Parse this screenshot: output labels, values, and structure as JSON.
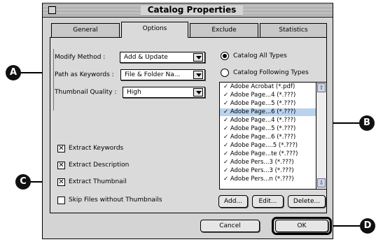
{
  "window": {
    "title": "Catalog Properties"
  },
  "tabs": [
    {
      "label": "General",
      "active": false
    },
    {
      "label": "Options",
      "active": true
    },
    {
      "label": "Exclude",
      "active": false
    },
    {
      "label": "Statistics",
      "active": false
    }
  ],
  "options": {
    "modify_method": {
      "label": "Modify Method :",
      "value": "Add & Update"
    },
    "path_as_keywords": {
      "label": "Path as Keywords :",
      "value": "File & Folder Na..."
    },
    "thumbnail_quality": {
      "label": "Thumbnail Quality :",
      "value": "High"
    }
  },
  "checkboxes": [
    {
      "label": "Extract Keywords",
      "checked": true
    },
    {
      "label": "Extract Description",
      "checked": true
    },
    {
      "label": "Extract Thumbnail",
      "checked": true
    },
    {
      "label": "Skip Files without Thumbnails",
      "checked": false
    }
  ],
  "catalog_types": {
    "all_label": "Catalog All Types",
    "following_label": "Catalog Following Types",
    "selected": "all"
  },
  "file_types": [
    {
      "label": "✓ Adobe Acrobat (*.pdf)",
      "selected": false
    },
    {
      "label": "✓ Adobe Page...4 (*.???)",
      "selected": false
    },
    {
      "label": "✓ Adobe Page...5 (*.???)",
      "selected": false
    },
    {
      "label": "✓ Adobe Page...6 (*.???)",
      "selected": true
    },
    {
      "label": "✓ Adobe Page...4 (*.???)",
      "selected": false
    },
    {
      "label": "✓ Adobe Page...5 (*.???)",
      "selected": false
    },
    {
      "label": "✓ Adobe Page...6 (*.???)",
      "selected": false
    },
    {
      "label": "✓ Adobe Page....5 (*.???)",
      "selected": false
    },
    {
      "label": "✓ Adobe Page...te (*.???)",
      "selected": false
    },
    {
      "label": "✓ Adobe Pers...3 (*.???)",
      "selected": false
    },
    {
      "label": "✓ Adobe Pers...3 (*.???)",
      "selected": false
    },
    {
      "label": "✓ Adobe Pers...n (*.???)",
      "selected": false
    }
  ],
  "list_buttons": {
    "add": "Add...",
    "edit": "Edit...",
    "delete": "Delete..."
  },
  "dialog_buttons": {
    "cancel": "Cancel",
    "ok": "OK"
  },
  "callouts": {
    "a": "A",
    "b": "B",
    "c": "C",
    "d": "D"
  },
  "scroll_arrows": {
    "up": "⇧",
    "down": "⇩"
  },
  "colors": {
    "selection": "#b9d3ee",
    "window_bg": "#d4d4d4",
    "callout": "#111111"
  }
}
